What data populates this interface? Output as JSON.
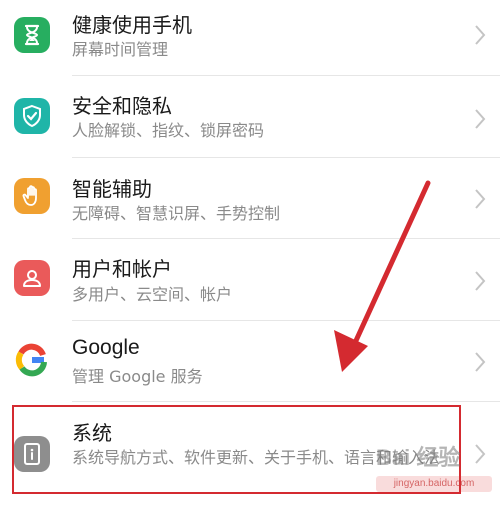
{
  "settings": {
    "items": [
      {
        "title": "健康使用手机",
        "subtitle": "屏幕时间管理",
        "icon": "hourglass-icon",
        "color": "#27ae60"
      },
      {
        "title": "安全和隐私",
        "subtitle": "人脸解锁、指纹、锁屏密码",
        "icon": "shield-check-icon",
        "color": "#1fb5a8"
      },
      {
        "title": "智能辅助",
        "subtitle": "无障碍、智慧识屏、手势控制",
        "icon": "hand-icon",
        "color": "#f0a030"
      },
      {
        "title": "用户和帐户",
        "subtitle": "多用户、云空间、帐户",
        "icon": "user-icon",
        "color": "#ea5a5a"
      },
      {
        "title": "Google",
        "subtitle": "管理 Google 服务",
        "icon": "google-g-icon",
        "color": "#4285f4"
      },
      {
        "title": "系统",
        "subtitle": "系统导航方式、软件更新、关于手机、语言和输入法",
        "icon": "phone-info-icon",
        "color": "#8e8e8e"
      }
    ]
  },
  "overlay": {
    "arrow_color": "#d42a30",
    "highlight_color": "#d42a30"
  },
  "watermark": {
    "brand": "Bai 经验",
    "url": "jingyan.baidu.com"
  }
}
